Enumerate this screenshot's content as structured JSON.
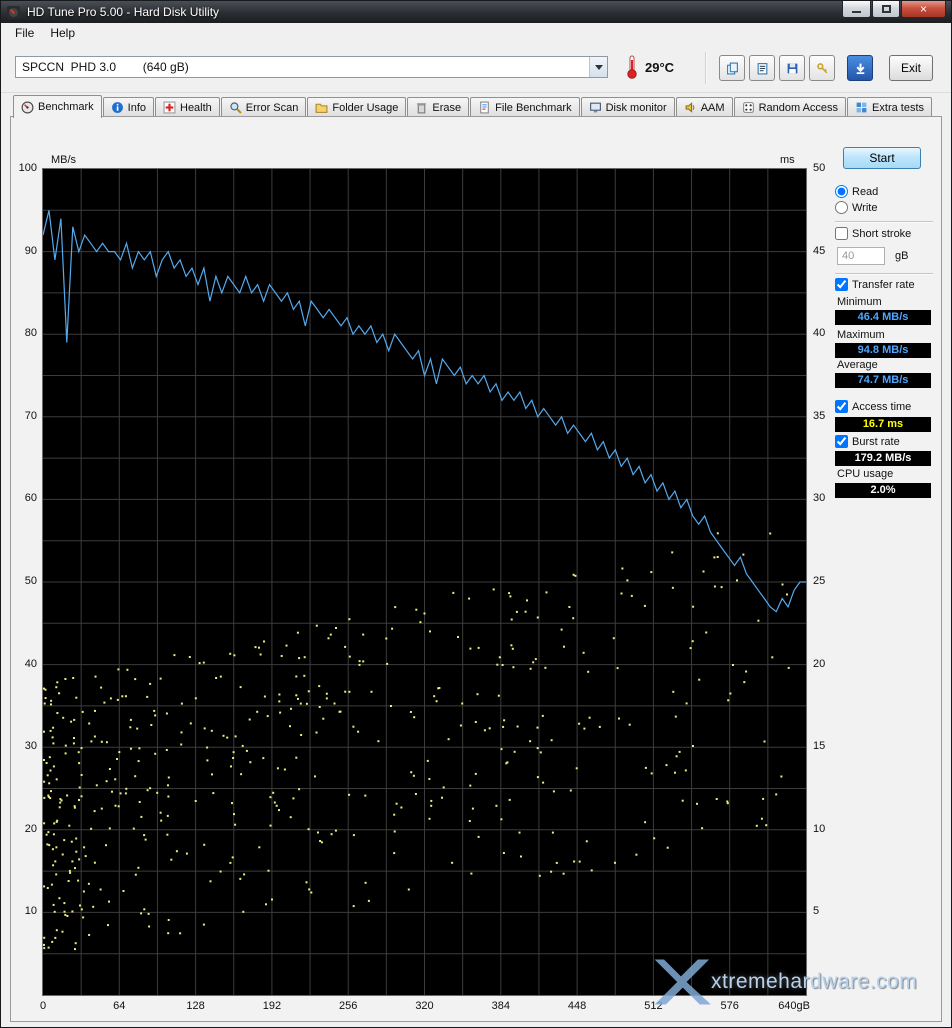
{
  "window": {
    "title": "HD Tune Pro 5.00 - Hard Disk Utility"
  },
  "menu": {
    "items": [
      "File",
      "Help"
    ]
  },
  "toolbar": {
    "drive_selected": "SPCCN  PHD 3.0        (640 gB)",
    "temperature": "29°C",
    "exit_label": "Exit",
    "buttons": [
      {
        "icon": "copy",
        "name": "copy-screenshot-button"
      },
      {
        "icon": "copytext",
        "name": "copy-text-button"
      },
      {
        "icon": "save",
        "name": "save-screenshot-button"
      },
      {
        "icon": "options",
        "name": "options-button"
      },
      {
        "icon": "download",
        "name": "update-button"
      }
    ]
  },
  "tabs": [
    {
      "label": "Benchmark",
      "icon": "gauge",
      "active": true
    },
    {
      "label": "Info",
      "icon": "info",
      "active": false
    },
    {
      "label": "Health",
      "icon": "health",
      "active": false
    },
    {
      "label": "Error Scan",
      "icon": "magnifier",
      "active": false
    },
    {
      "label": "Folder Usage",
      "icon": "folder",
      "active": false
    },
    {
      "label": "Erase",
      "icon": "erase",
      "active": false
    },
    {
      "label": "File Benchmark",
      "icon": "page",
      "active": false
    },
    {
      "label": "Disk monitor",
      "icon": "monitor",
      "active": false
    },
    {
      "label": "AAM",
      "icon": "speaker",
      "active": false
    },
    {
      "label": "Random Access",
      "icon": "random",
      "active": false
    },
    {
      "label": "Extra tests",
      "icon": "extra",
      "active": false
    }
  ],
  "side_panel": {
    "start_label": "Start",
    "read_label": "Read",
    "write_label": "Write",
    "short_stroke_label": "Short stroke",
    "short_stroke_value": "40",
    "short_stroke_unit": "gB",
    "transfer_rate_label": "Transfer rate",
    "minimum_label": "Minimum",
    "minimum_value": "46.4 MB/s",
    "maximum_label": "Maximum",
    "maximum_value": "94.8 MB/s",
    "average_label": "Average",
    "average_value": "74.7 MB/s",
    "access_time_label": "Access time",
    "access_time_value": "16.7 ms",
    "burst_rate_label": "Burst rate",
    "burst_rate_value": "179.2 MB/s",
    "cpu_usage_label": "CPU usage",
    "cpu_usage_value": "2.0%"
  },
  "colors": {
    "transfer_line": "#55aaee",
    "access_dot": "#eded7e",
    "value_blue": "#4da6ff",
    "value_yellow": "#ffff00",
    "value_white": "#ffffff",
    "grid": "#3c3c3c"
  },
  "watermark": "xtremehardware.com",
  "chart_data": {
    "type": "line+scatter",
    "title": "HD Tune Pro benchmark - transfer rate (blue line, MB/s) and access time (yellow dots, ms) vs disk position (gB)",
    "left_axis": {
      "unit": "MB/s",
      "min": 0,
      "max": 100,
      "ticks": [
        100,
        90,
        80,
        70,
        60,
        50,
        40,
        30,
        20,
        10
      ]
    },
    "right_axis": {
      "unit": "ms",
      "min": 0,
      "max": 50,
      "ticks": [
        50,
        45,
        40,
        35,
        30,
        25,
        20,
        15,
        10,
        5
      ]
    },
    "x_axis": {
      "min": 0,
      "max": 640,
      "ticks": [
        0,
        64,
        128,
        192,
        256,
        320,
        384,
        448,
        512,
        576
      ],
      "end_label": "640gB",
      "grid_step": 32
    },
    "grid": {
      "y_step": 5
    },
    "transfer_rate": {
      "series_name": "Transfer rate (MB/s)",
      "x_step": 5,
      "values": [
        92,
        95,
        89,
        94,
        79,
        93,
        90,
        92,
        91,
        90,
        91,
        90,
        90,
        89,
        91,
        88,
        90,
        89,
        90,
        87,
        89,
        90,
        88,
        89,
        87,
        88,
        86,
        88,
        84,
        87,
        85,
        87,
        86,
        85,
        87,
        85,
        86,
        84,
        86,
        85,
        84,
        85,
        83,
        84,
        81,
        84,
        83,
        82,
        83,
        82,
        81,
        82,
        80,
        81,
        80,
        81,
        79,
        80,
        78,
        80,
        79,
        78,
        77,
        78,
        75,
        77,
        74,
        77,
        76,
        75,
        76,
        74,
        75,
        74,
        75,
        73,
        74,
        72,
        73,
        72,
        73,
        71,
        72,
        70,
        71,
        70,
        69,
        70,
        68,
        69,
        68,
        67,
        68,
        66,
        67,
        65,
        66,
        64,
        65,
        63,
        64,
        62,
        63,
        61,
        62,
        60,
        61,
        59,
        60,
        58,
        57,
        58,
        56,
        55,
        54,
        53,
        52,
        53,
        51,
        50,
        49,
        48,
        47,
        46.4,
        48,
        47,
        49,
        50,
        50
      ]
    },
    "access_scatter": {
      "series_name": "Access time (ms)",
      "seed": 7,
      "count": 500,
      "x_max": 625,
      "x_bias": 1.8,
      "ms_lo_base": 2.5,
      "ms_lo_slope": 0.011,
      "ms_hi_base": 19,
      "ms_hi_slope": 0.016,
      "ms_hi_cap": 29
    }
  }
}
